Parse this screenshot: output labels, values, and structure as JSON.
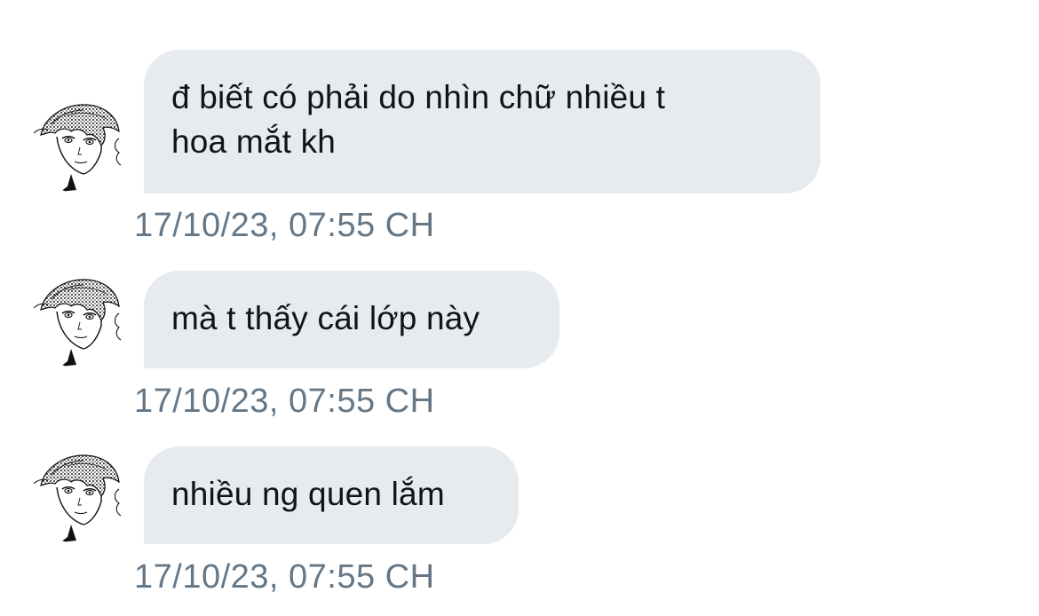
{
  "messages": [
    {
      "text": "đ biết có phải do nhìn chữ nhiều t\nhoa mắt kh",
      "timestamp": "17/10/23, 07:55 CH",
      "avatar_icon": "anime-character-avatar-icon"
    },
    {
      "text": "mà t thấy cái lớp này",
      "timestamp": "17/10/23, 07:55 CH",
      "avatar_icon": "anime-character-avatar-icon"
    },
    {
      "text": "nhiều ng quen lắm",
      "timestamp": "17/10/23, 07:55 CH",
      "avatar_icon": "anime-character-avatar-icon"
    }
  ],
  "colors": {
    "bubble_background": "#e7ebef",
    "message_text": "#0f1419",
    "timestamp_text": "#657786",
    "page_background": "#ffffff"
  }
}
